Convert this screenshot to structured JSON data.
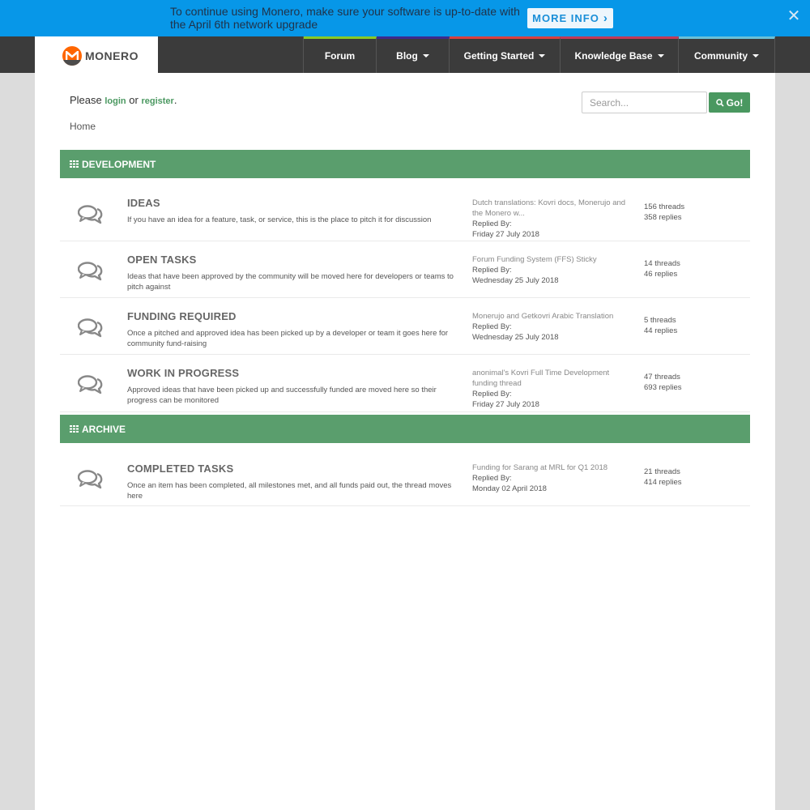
{
  "banner": {
    "message": "To continue using Monero, make sure your software is up-to-date with the April 6th network upgrade",
    "button_label": "MORE INFO",
    "button_chevron": "›",
    "close_glyph": "✕"
  },
  "nav": {
    "logo_text": "MONERO",
    "items": [
      {
        "label": "Forum",
        "accent": "#8ac926",
        "has_caret": false
      },
      {
        "label": "Blog",
        "accent": "#3d2a8c",
        "has_caret": true
      },
      {
        "label": "Getting Started",
        "accent": "#d94040",
        "has_caret": true
      },
      {
        "label": "Knowledge Base",
        "accent": "#c23a58",
        "has_caret": true
      },
      {
        "label": "Community",
        "accent": "#6ac0d8",
        "has_caret": true
      }
    ]
  },
  "auth": {
    "prefix": "Please",
    "login": "login",
    "middle": "or",
    "register": "register",
    "suffix": "."
  },
  "search": {
    "placeholder": "Search...",
    "button_label": "Go!"
  },
  "breadcrumb": "Home",
  "colors": {
    "accent_green": "#5a9e6d",
    "brand_orange": "#ff6600",
    "banner_blue": "#0797e8"
  },
  "categories": [
    {
      "name": "DEVELOPMENT",
      "forums": [
        {
          "title": "IDEAS",
          "description": "If you have an idea for a feature, task, or service, this is the place to pitch it for discussion",
          "last_thread": "Dutch translations: Kovri docs, Monerujo and the Monero w...",
          "replied_by": "Replied By:",
          "date": "Friday 27 July 2018",
          "threads": "156 threads",
          "replies": "358 replies"
        },
        {
          "title": "OPEN TASKS",
          "description": "Ideas that have been approved by the community will be moved here for developers or teams to pitch against",
          "last_thread": "Forum Funding System (FFS) Sticky",
          "replied_by": "Replied By:",
          "date": "Wednesday 25 July 2018",
          "threads": "14 threads",
          "replies": "46 replies"
        },
        {
          "title": "FUNDING REQUIRED",
          "description": "Once a pitched and approved idea has been picked up by a developer or team it goes here for community fund-raising",
          "last_thread": "Monerujo and Getkovri Arabic Translation",
          "replied_by": "Replied By:",
          "date": "Wednesday 25 July 2018",
          "threads": "5 threads",
          "replies": "44 replies"
        },
        {
          "title": "WORK IN PROGRESS",
          "description": "Approved ideas that have been picked up and successfully funded are moved here so their progress can be monitored",
          "last_thread": "anonimal's Kovri Full Time Development funding thread",
          "replied_by": "Replied By:",
          "date": "Friday 27 July 2018",
          "threads": "47 threads",
          "replies": "693 replies"
        }
      ]
    },
    {
      "name": "ARCHIVE",
      "forums": [
        {
          "title": "COMPLETED TASKS",
          "description": "Once an item has been completed, all milestones met, and all funds paid out, the thread moves here",
          "last_thread": "Funding for Sarang at MRL for Q1 2018",
          "replied_by": "Replied By:",
          "date": "Monday 02 April 2018",
          "threads": "21 threads",
          "replies": "414 replies"
        }
      ]
    }
  ]
}
